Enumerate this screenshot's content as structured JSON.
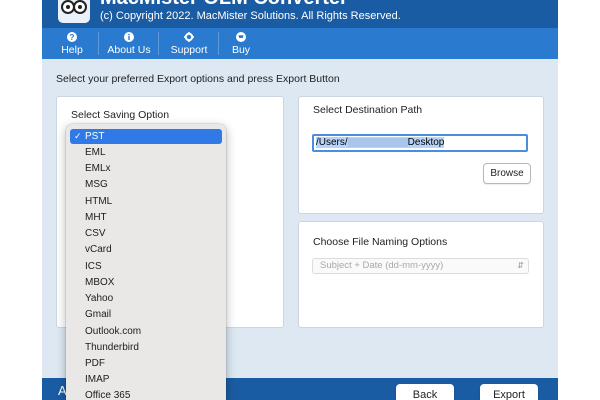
{
  "app": {
    "name": "MacMister OLM Converter",
    "copyright": "(c) Copyright 2022. MacMister Solutions. All Rights Reserved."
  },
  "menu": [
    {
      "label": "Help",
      "icon": "help-icon"
    },
    {
      "label": "About Us",
      "icon": "info-icon"
    },
    {
      "label": "Support",
      "icon": "gear-icon"
    },
    {
      "label": "Buy",
      "icon": "cart-icon"
    }
  ],
  "instructions": "Select your preferred Export options and press Export Button",
  "saving_option": {
    "heading": "Select Saving Option",
    "selected": "PST",
    "options": [
      "PST",
      "EML",
      "EMLx",
      "MSG",
      "HTML",
      "MHT",
      "CSV",
      "vCard",
      "ICS",
      "MBOX",
      "Yahoo",
      "Gmail",
      "Outlook.com",
      "Thunderbird",
      "PDF",
      "IMAP",
      "Office 365"
    ]
  },
  "destination": {
    "heading": "Select Destination Path",
    "path_prefix": "/Users/",
    "path_suffix": "Desktop",
    "browse_label": "Browse"
  },
  "naming": {
    "heading": "Choose File Naming Options",
    "value": "Subject + Date (dd-mm-yyyy)"
  },
  "bottom": {
    "left_text": "A",
    "back_label": "Back",
    "export_label": "Export"
  },
  "colors": {
    "title_bar": "#1a5ca3",
    "menu_bar": "#2a7bd0",
    "window_bg": "#dde8f3",
    "selection": "#2f7ae6"
  }
}
